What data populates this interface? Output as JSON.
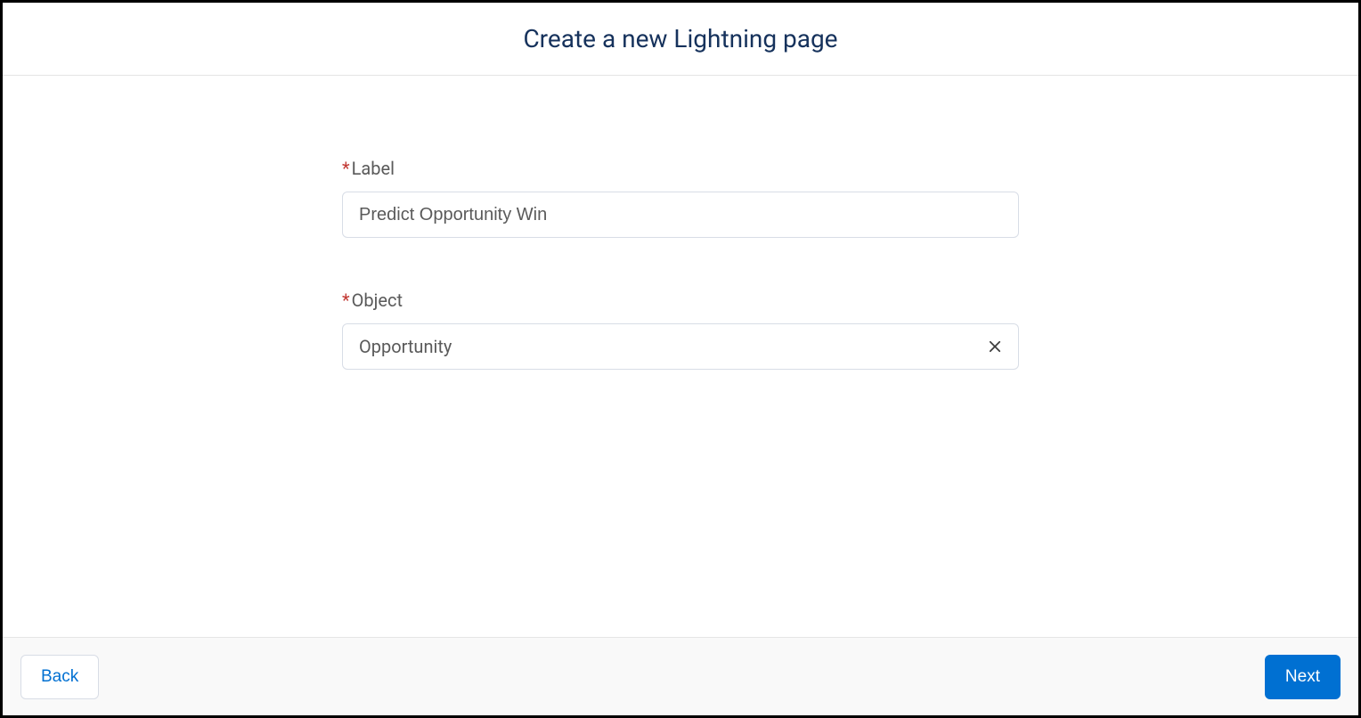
{
  "header": {
    "title": "Create a new Lightning page"
  },
  "form": {
    "required_indicator": "*",
    "label_field": {
      "label": "Label",
      "value": "Predict Opportunity Win"
    },
    "object_field": {
      "label": "Object",
      "value": "Opportunity"
    }
  },
  "footer": {
    "back_label": "Back",
    "next_label": "Next"
  }
}
